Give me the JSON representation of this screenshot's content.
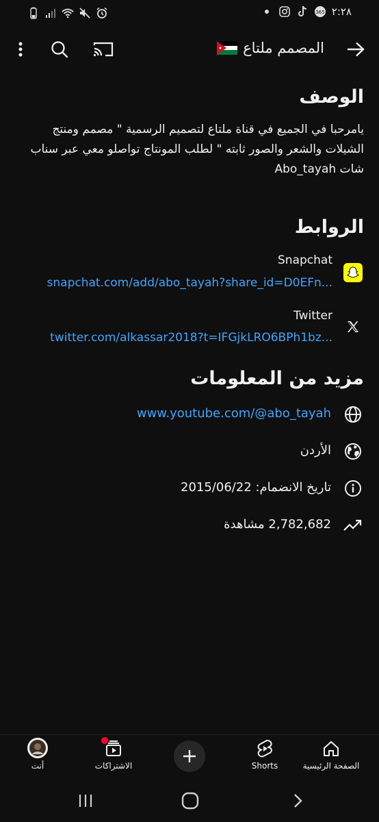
{
  "status_bar": {
    "time": "٢:٢٨",
    "left_icons": [
      "battery-icon",
      "signal-icon",
      "wifi-icon",
      "mute-icon",
      "alarm-icon"
    ],
    "right_icons": [
      "dot-icon",
      "instagram-icon",
      "tiktok-icon",
      "app-icon"
    ]
  },
  "app_bar": {
    "title": "المصمم ملتاع",
    "flag": "jordan-flag"
  },
  "description": {
    "title": "الوصف",
    "text": "يامرحبا في الجميع في قناة ملتاع لتصميم الرسمية  \" مصمم ومنتج الشيلات والشعر والصور ثابته \" لطلب المونتاج تواصلو معي عبر سناب شات Abo_tayah"
  },
  "links": {
    "title": "الروابط",
    "items": [
      {
        "label": "Snapchat",
        "url": "snapchat.com/add/abo_tayah?share_id=D0EFn...",
        "icon": "snapchat-icon"
      },
      {
        "label": "Twitter",
        "url": "twitter.com/alkassar2018?t=IFGjkLRO6BPh1bz...",
        "icon": "x-icon"
      }
    ]
  },
  "more_info": {
    "title": "مزيد من المعلومات",
    "website": "www.youtube.com/@abo_tayah",
    "country": "الأردن",
    "joined": "تاريخ الانضمام: 2015/06/22",
    "views": "2,782,682 مشاهدة"
  },
  "bottom_nav": {
    "home": "الصفحة الرئيسية",
    "shorts": "Shorts",
    "subscriptions": "الاشتراكات",
    "you": "أنت"
  },
  "colors": {
    "background": "#0f0f0f",
    "link": "#3ea6ff",
    "snapchat": "#fffc00",
    "notification": "#ff0033"
  }
}
